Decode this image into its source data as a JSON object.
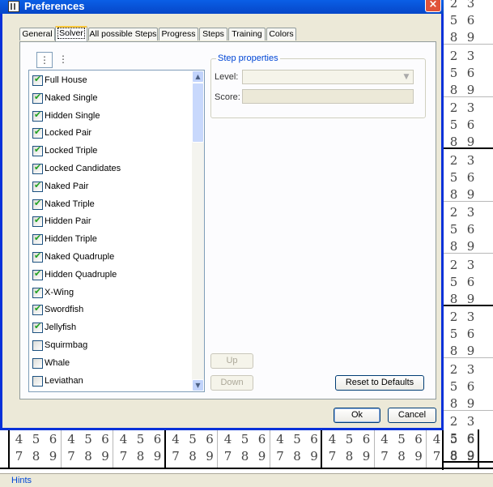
{
  "dialog": {
    "title": "Preferences",
    "close_label": "×",
    "tabs": [
      "General",
      "Solver",
      "All possible Steps",
      "Progress",
      "Steps",
      "Training",
      "Colors"
    ],
    "active_tab": "Solver"
  },
  "toolbar": {
    "expand_icon": "tree-expand-icon",
    "collapse_icon": "tree-collapse-icon"
  },
  "steps": [
    {
      "label": "Full House",
      "checked": true
    },
    {
      "label": "Naked Single",
      "checked": true
    },
    {
      "label": "Hidden Single",
      "checked": true
    },
    {
      "label": "Locked Pair",
      "checked": true
    },
    {
      "label": "Locked Triple",
      "checked": true
    },
    {
      "label": "Locked Candidates",
      "checked": true
    },
    {
      "label": "Naked Pair",
      "checked": true
    },
    {
      "label": "Naked Triple",
      "checked": true
    },
    {
      "label": "Hidden Pair",
      "checked": true
    },
    {
      "label": "Hidden Triple",
      "checked": true
    },
    {
      "label": "Naked Quadruple",
      "checked": true
    },
    {
      "label": "Hidden Quadruple",
      "checked": true
    },
    {
      "label": "X-Wing",
      "checked": true
    },
    {
      "label": "Swordfish",
      "checked": true
    },
    {
      "label": "Jellyfish",
      "checked": true
    },
    {
      "label": "Squirmbag",
      "checked": false
    },
    {
      "label": "Whale",
      "checked": false
    },
    {
      "label": "Leviathan",
      "checked": false
    }
  ],
  "step_properties": {
    "title": "Step properties",
    "level_label": "Level:",
    "level_value": "",
    "score_label": "Score:",
    "score_value": ""
  },
  "buttons": {
    "up": "Up",
    "down": "Down",
    "reset": "Reset to Defaults",
    "ok": "Ok",
    "cancel": "Cancel"
  },
  "background": {
    "hints_label": "Hints",
    "column_candidates": [
      "2",
      "3",
      "5",
      "6",
      "8",
      "9"
    ],
    "row_candidates": [
      "4",
      "5",
      "6",
      "7",
      "8",
      "9"
    ]
  }
}
